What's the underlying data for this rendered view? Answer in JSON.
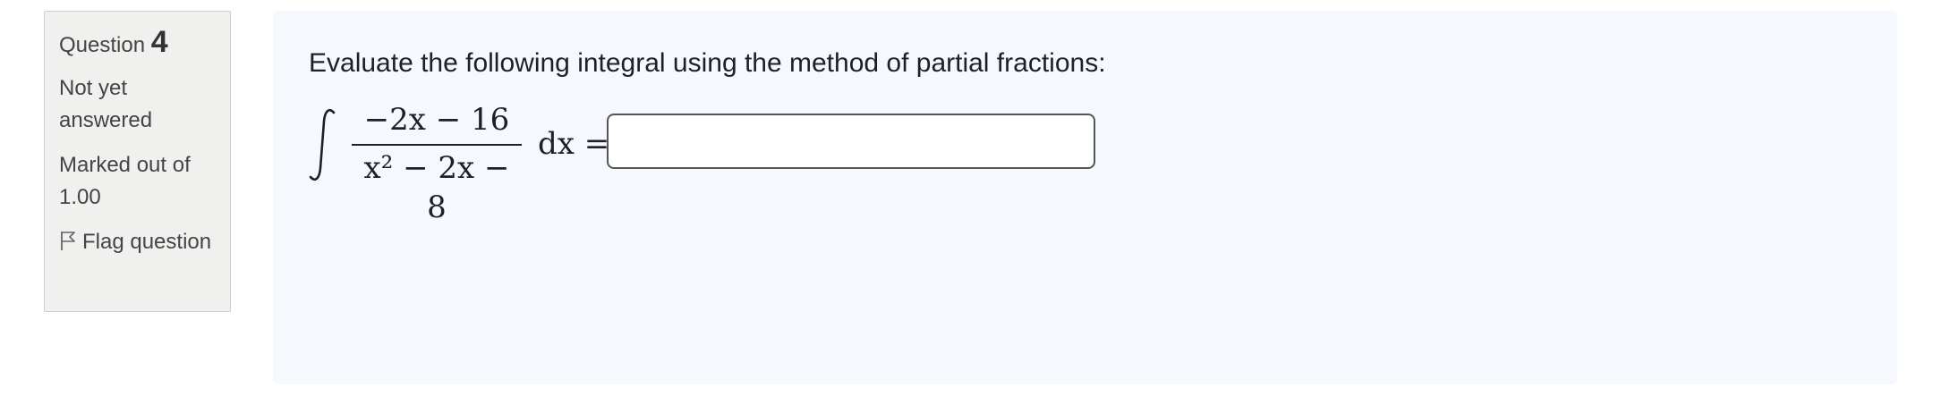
{
  "question_info": {
    "label": "Question",
    "number": "4",
    "state": "Not yet answered",
    "grade": "Marked out of 1.00",
    "flag_label": "Flag question",
    "flag_icon": "flag-icon"
  },
  "question": {
    "text": "Evaluate the following integral using the method of partial fractions:",
    "formula": {
      "integral_symbol": "∫",
      "numerator": "−2x − 16",
      "denominator": "x² − 2x − 8",
      "suffix": "dx ="
    },
    "answer": {
      "value": "",
      "placeholder": ""
    }
  },
  "colors": {
    "info_bg": "#f0f0ee",
    "content_bg": "#f5f8fc",
    "text": "#1d2125"
  }
}
